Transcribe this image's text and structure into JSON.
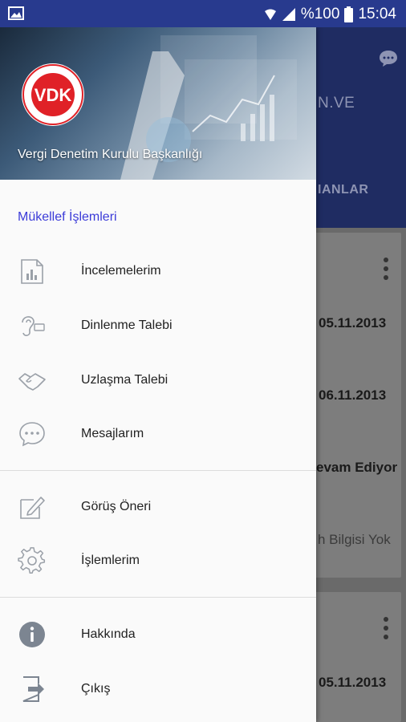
{
  "status_bar": {
    "battery_percent": "%100",
    "time": "15:04"
  },
  "background": {
    "title_fragment": "N.VE",
    "tab_fragment": "IANLAR",
    "rows": [
      {
        "text": "05.11.2013"
      },
      {
        "text": "06.11.2013"
      },
      {
        "text": "evam Ediyor"
      },
      {
        "text": "h Bilgisi Yok"
      },
      {
        "text": "05.11.2013"
      }
    ]
  },
  "drawer": {
    "header_title": "Vergi Denetim Kurulu Başkanlığı",
    "logo_text": "VDK",
    "section_title": "Mükellef İşlemleri",
    "group1": [
      {
        "label": "İncelemelerim",
        "icon": "report-icon"
      },
      {
        "label": "Dinlenme Talebi",
        "icon": "hearing-icon"
      },
      {
        "label": "Uzlaşma Talebi",
        "icon": "handshake-icon"
      },
      {
        "label": "Mesajlarım",
        "icon": "chat-bubble-icon"
      }
    ],
    "group2": [
      {
        "label": "Görüş Öneri",
        "icon": "edit-icon"
      },
      {
        "label": "İşlemlerim",
        "icon": "settings-gear-icon"
      }
    ],
    "group3": [
      {
        "label": "Hakkında",
        "icon": "info-icon"
      },
      {
        "label": "Çıkış",
        "icon": "exit-icon"
      }
    ]
  },
  "colors": {
    "status_bar": "#283a8e",
    "section_title": "#3b3bd8",
    "logo_red": "#e02127"
  }
}
